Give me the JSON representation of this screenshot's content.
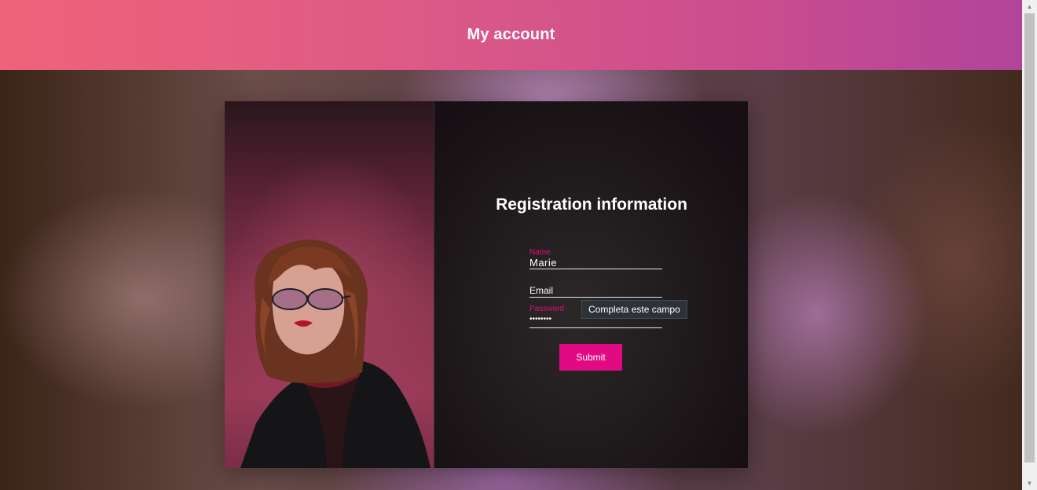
{
  "header": {
    "title": "My account"
  },
  "form": {
    "title": "Registration information",
    "name_label": "Name",
    "name_value": "Marie",
    "email_label": "Email",
    "password_label": "Password",
    "password_value": "••••••••",
    "submit_label": "Submit"
  },
  "tooltip": {
    "text": "Completa este campo"
  },
  "colors": {
    "header_gradient_start": "#f06279",
    "header_gradient_end": "#b1449a",
    "accent": "#e10a82",
    "panel": "#211b1e"
  },
  "icons": {
    "scroll_up": "chevron-up-icon",
    "scroll_down": "chevron-down-icon"
  }
}
